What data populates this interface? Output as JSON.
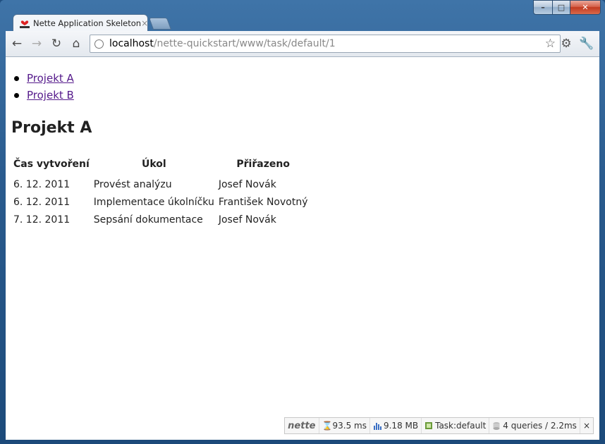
{
  "browser": {
    "tab_title": "Nette Application Skeleton",
    "tab_close": "×",
    "url_host": "localhost",
    "url_path": "/nette-quickstart/www/task/default/1"
  },
  "menu": [
    {
      "label": "Projekt A"
    },
    {
      "label": "Projekt B"
    }
  ],
  "page": {
    "heading": "Projekt A"
  },
  "table": {
    "headers": [
      "Čas vytvoření",
      "Úkol",
      "Přiřazeno"
    ],
    "rows": [
      {
        "date": "6. 12. 2011",
        "task": "Provést analýzu",
        "assigned": "Josef Novák"
      },
      {
        "date": "6. 12. 2011",
        "task": "Implementace úkolníčku",
        "assigned": "František Novotný"
      },
      {
        "date": "7. 12. 2011",
        "task": "Sepsání dokumentace",
        "assigned": "Josef Novák"
      }
    ]
  },
  "debug_bar": {
    "logo": "nette",
    "time": "93.5 ms",
    "memory": "9.18 MB",
    "presenter": "Task:default",
    "queries": "4 queries / 2.2ms",
    "close": "×"
  }
}
